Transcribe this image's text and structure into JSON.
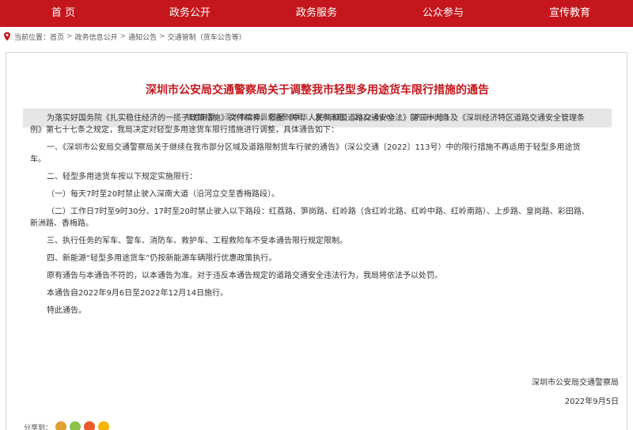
{
  "nav": {
    "items": [
      {
        "label": "首  页"
      },
      {
        "label": "政务公开"
      },
      {
        "label": "政务服务"
      },
      {
        "label": "公众参与"
      },
      {
        "label": "宣传教育"
      }
    ]
  },
  "breadcrumb": {
    "prefix": "当前位置：",
    "items": [
      "首页",
      "政务信息公开",
      "通知公告",
      "交通管制（货车公告等）"
    ],
    "separator": ">"
  },
  "article": {
    "title": "深圳市公安局交通警察局关于调整我市轻型多用途货车限行措施的通告",
    "info": {
      "source_label": "信息来源：",
      "source": "深圳市公安局交通警察局",
      "date_label": "发布日期：",
      "date": "2022-09-05",
      "correct": "[ 内容纠错 ]"
    },
    "paragraphs": [
      "为落实好国务院《扎实稳住经济的一揽子政策措施》文件精神，根据《中华人民共和国道路交通安全法》第三十九条及《深圳经济特区道路交通安全管理条例》第七十七条之规定，我局决定对轻型多用途货车限行措施进行调整，具体通告如下：",
      "一、《深圳市公安局交通警察局关于继续在我市部分区域及道路限制货车行驶的通告》（深公交通〔2022〕113号）中的限行措施不再适用于轻型多用途货车。",
      "二、轻型多用途货车按以下规定实施限行：",
      "（一）每天7时至20时禁止驶入深南大道（沿河立交至香梅路段）。",
      "（二）工作日7时至9时30分、17时至20时禁止驶入以下路段：红荔路、笋岗路、红岭路（含红岭北路、红岭中路、红岭南路）、上步路、皇岗路、彩田路、新洲路、香梅路。",
      "三、执行任务的军车、警车、消防车、救护车、工程救险车不受本通告限行规定限制。",
      "四、新能源“轻型多用途货车”仍按新能源车辆限行优惠政策执行。",
      "原有通告与本通告不符的，以本通告为准。对于违反本通告规定的道路交通安全违法行为，我局将依法予以处罚。",
      "本通告自2022年9月6日至2022年12月14日施行。",
      "特此通告。"
    ],
    "signature": "深圳市公安局交通警察局",
    "sign_date": "2022年9月5日"
  },
  "share": {
    "label": "分享到：",
    "colors": [
      "#e0a030",
      "#8bc34a",
      "#e85a2e",
      "#f5b400"
    ]
  },
  "colors": {
    "accent": "#c4161c",
    "infobar": "#e6e6e6"
  }
}
